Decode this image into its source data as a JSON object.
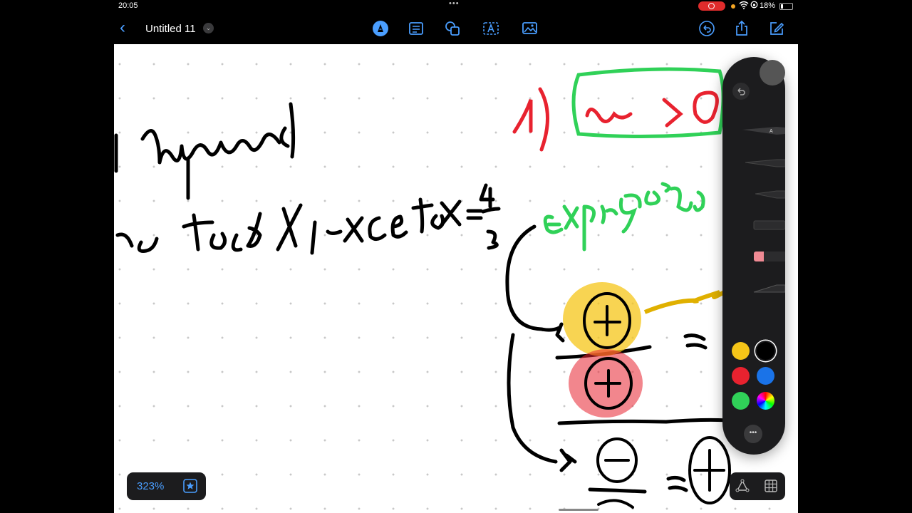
{
  "status": {
    "time": "20:05",
    "battery": "18%"
  },
  "toolbar": {
    "back": "‹",
    "title": "Untitled 11"
  },
  "zoom": {
    "value": "323%"
  },
  "ink": {
    "line1": "n enquanto :",
    "line2": "na todo x, exceto x=",
    "frac_num": "4",
    "frac_den": "3",
    "item_number": "1)",
    "boxed": "~ > 0",
    "green": "expressão =",
    "plus": "+",
    "minus": "−",
    "equals": "="
  },
  "palette": {
    "colors": [
      "#f5c518",
      "#000000",
      "#e8222f",
      "#1a73e8",
      "#30d158",
      "conic"
    ],
    "selected_color_index": 1
  }
}
